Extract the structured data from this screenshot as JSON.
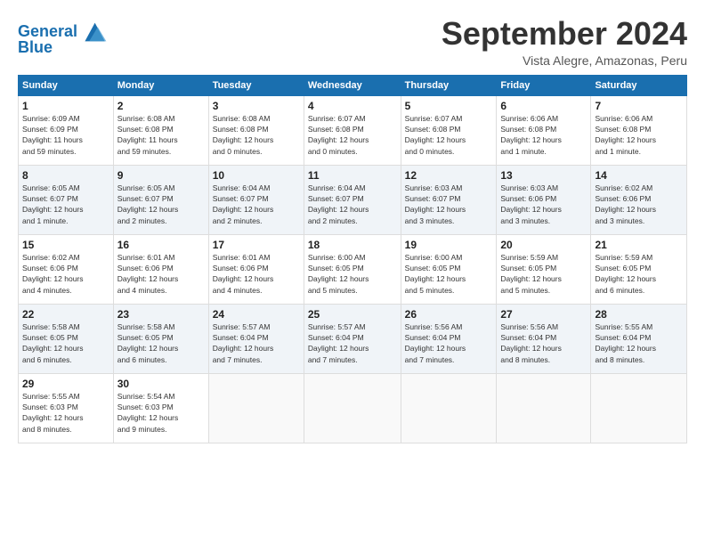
{
  "logo": {
    "line1": "General",
    "line2": "Blue"
  },
  "title": "September 2024",
  "subtitle": "Vista Alegre, Amazonas, Peru",
  "headers": [
    "Sunday",
    "Monday",
    "Tuesday",
    "Wednesday",
    "Thursday",
    "Friday",
    "Saturday"
  ],
  "weeks": [
    [
      {
        "day": "1",
        "info": "Sunrise: 6:09 AM\nSunset: 6:09 PM\nDaylight: 11 hours\nand 59 minutes."
      },
      {
        "day": "2",
        "info": "Sunrise: 6:08 AM\nSunset: 6:08 PM\nDaylight: 11 hours\nand 59 minutes."
      },
      {
        "day": "3",
        "info": "Sunrise: 6:08 AM\nSunset: 6:08 PM\nDaylight: 12 hours\nand 0 minutes."
      },
      {
        "day": "4",
        "info": "Sunrise: 6:07 AM\nSunset: 6:08 PM\nDaylight: 12 hours\nand 0 minutes."
      },
      {
        "day": "5",
        "info": "Sunrise: 6:07 AM\nSunset: 6:08 PM\nDaylight: 12 hours\nand 0 minutes."
      },
      {
        "day": "6",
        "info": "Sunrise: 6:06 AM\nSunset: 6:08 PM\nDaylight: 12 hours\nand 1 minute."
      },
      {
        "day": "7",
        "info": "Sunrise: 6:06 AM\nSunset: 6:08 PM\nDaylight: 12 hours\nand 1 minute."
      }
    ],
    [
      {
        "day": "8",
        "info": "Sunrise: 6:05 AM\nSunset: 6:07 PM\nDaylight: 12 hours\nand 1 minute."
      },
      {
        "day": "9",
        "info": "Sunrise: 6:05 AM\nSunset: 6:07 PM\nDaylight: 12 hours\nand 2 minutes."
      },
      {
        "day": "10",
        "info": "Sunrise: 6:04 AM\nSunset: 6:07 PM\nDaylight: 12 hours\nand 2 minutes."
      },
      {
        "day": "11",
        "info": "Sunrise: 6:04 AM\nSunset: 6:07 PM\nDaylight: 12 hours\nand 2 minutes."
      },
      {
        "day": "12",
        "info": "Sunrise: 6:03 AM\nSunset: 6:07 PM\nDaylight: 12 hours\nand 3 minutes."
      },
      {
        "day": "13",
        "info": "Sunrise: 6:03 AM\nSunset: 6:06 PM\nDaylight: 12 hours\nand 3 minutes."
      },
      {
        "day": "14",
        "info": "Sunrise: 6:02 AM\nSunset: 6:06 PM\nDaylight: 12 hours\nand 3 minutes."
      }
    ],
    [
      {
        "day": "15",
        "info": "Sunrise: 6:02 AM\nSunset: 6:06 PM\nDaylight: 12 hours\nand 4 minutes."
      },
      {
        "day": "16",
        "info": "Sunrise: 6:01 AM\nSunset: 6:06 PM\nDaylight: 12 hours\nand 4 minutes."
      },
      {
        "day": "17",
        "info": "Sunrise: 6:01 AM\nSunset: 6:06 PM\nDaylight: 12 hours\nand 4 minutes."
      },
      {
        "day": "18",
        "info": "Sunrise: 6:00 AM\nSunset: 6:05 PM\nDaylight: 12 hours\nand 5 minutes."
      },
      {
        "day": "19",
        "info": "Sunrise: 6:00 AM\nSunset: 6:05 PM\nDaylight: 12 hours\nand 5 minutes."
      },
      {
        "day": "20",
        "info": "Sunrise: 5:59 AM\nSunset: 6:05 PM\nDaylight: 12 hours\nand 5 minutes."
      },
      {
        "day": "21",
        "info": "Sunrise: 5:59 AM\nSunset: 6:05 PM\nDaylight: 12 hours\nand 6 minutes."
      }
    ],
    [
      {
        "day": "22",
        "info": "Sunrise: 5:58 AM\nSunset: 6:05 PM\nDaylight: 12 hours\nand 6 minutes."
      },
      {
        "day": "23",
        "info": "Sunrise: 5:58 AM\nSunset: 6:05 PM\nDaylight: 12 hours\nand 6 minutes."
      },
      {
        "day": "24",
        "info": "Sunrise: 5:57 AM\nSunset: 6:04 PM\nDaylight: 12 hours\nand 7 minutes."
      },
      {
        "day": "25",
        "info": "Sunrise: 5:57 AM\nSunset: 6:04 PM\nDaylight: 12 hours\nand 7 minutes."
      },
      {
        "day": "26",
        "info": "Sunrise: 5:56 AM\nSunset: 6:04 PM\nDaylight: 12 hours\nand 7 minutes."
      },
      {
        "day": "27",
        "info": "Sunrise: 5:56 AM\nSunset: 6:04 PM\nDaylight: 12 hours\nand 8 minutes."
      },
      {
        "day": "28",
        "info": "Sunrise: 5:55 AM\nSunset: 6:04 PM\nDaylight: 12 hours\nand 8 minutes."
      }
    ],
    [
      {
        "day": "29",
        "info": "Sunrise: 5:55 AM\nSunset: 6:03 PM\nDaylight: 12 hours\nand 8 minutes."
      },
      {
        "day": "30",
        "info": "Sunrise: 5:54 AM\nSunset: 6:03 PM\nDaylight: 12 hours\nand 9 minutes."
      },
      {
        "day": "",
        "info": ""
      },
      {
        "day": "",
        "info": ""
      },
      {
        "day": "",
        "info": ""
      },
      {
        "day": "",
        "info": ""
      },
      {
        "day": "",
        "info": ""
      }
    ]
  ]
}
